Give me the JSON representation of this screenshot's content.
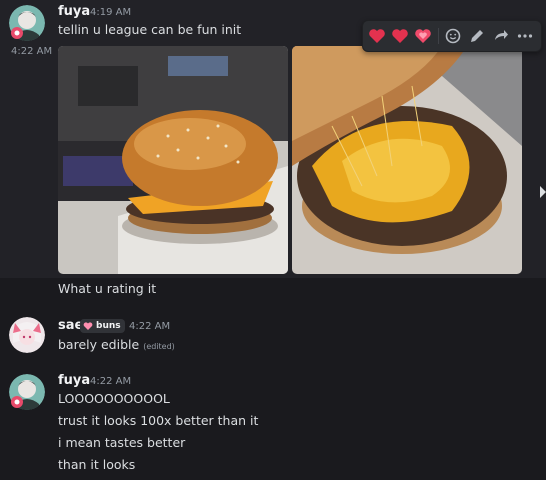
{
  "colors": {
    "background": "#1a1a1e",
    "hover_background": "#222227",
    "reaction_heart": "#e3324f",
    "username": "#f2f3f5",
    "timestamp": "#949ba4",
    "message_text": "#dbdee1"
  },
  "message_1": {
    "username": "fuya",
    "timestamp": "4:19 AM",
    "text": "tellin u league can be fun init",
    "continuation_timestamp": "4:22 AM",
    "images": [
      {
        "alt": "cheeseburger on desk photo"
      },
      {
        "alt": "cheeseburger bun lifted photo"
      }
    ],
    "followup_text": "What u rating it"
  },
  "hover_toolbar": {
    "reactions": [
      "red-heart",
      "red-heart",
      "red-heart"
    ],
    "actions": [
      "add-reaction-icon",
      "edit-icon",
      "reply-icon",
      "more-icon"
    ]
  },
  "message_2": {
    "username": "sae",
    "tag_label": "buns",
    "timestamp": "4:22 AM",
    "text": "barely edible",
    "edited_label": "(edited)"
  },
  "message_3": {
    "username": "fuya",
    "timestamp": "4:22 AM",
    "lines": [
      "LOOOOOOOOOOL",
      "trust it looks 100x better than it",
      "i mean tastes better",
      "than it looks"
    ]
  }
}
